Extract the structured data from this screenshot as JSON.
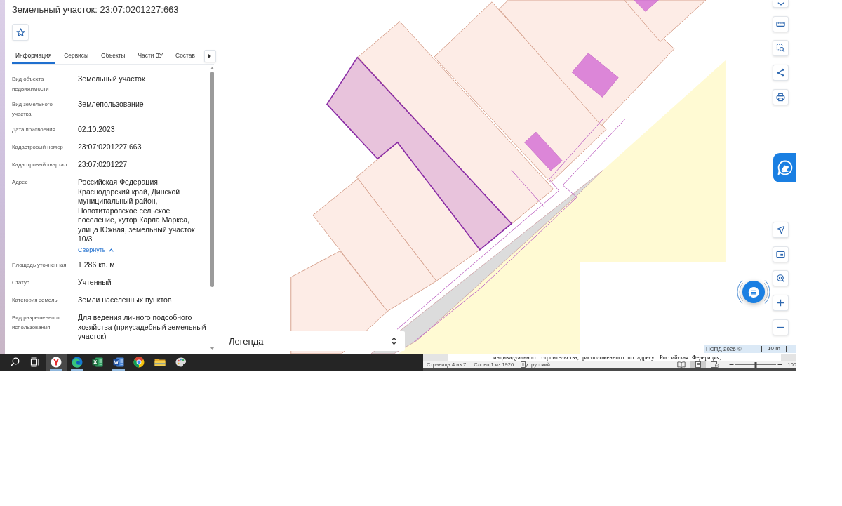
{
  "panel": {
    "title": "Земельный участок: 23:07:0201227:663",
    "tabs": [
      {
        "label": "Информация",
        "selected": true
      },
      {
        "label": "Сервисы",
        "selected": false
      },
      {
        "label": "Объекты",
        "selected": false
      },
      {
        "label": "Части ЗУ",
        "selected": false
      },
      {
        "label": "Состав",
        "selected": false
      }
    ],
    "fields": [
      {
        "label": "Вид объекта\nнедвижимости",
        "value": "Земельный участок"
      },
      {
        "label": "Вид земельного\nучастка",
        "value": "Землепользование"
      },
      {
        "label": "Дата присвоения",
        "value": "02.10.2023"
      },
      {
        "label": "Кадастровый номер",
        "value": "23:07:0201227:663"
      },
      {
        "label": "Кадастровый квартал",
        "value": "23:07:0201227"
      },
      {
        "label": "Адрес",
        "value": "Российская Федерация,\nКраснодарский край, Динской\nмуниципальный район,\nНовотитаровское сельское\nпоселение, хутор Карла Маркса,\nулица Южная, земельный участок\n10/3",
        "toggle": "Свернуть",
        "expanded": true
      },
      {
        "label": "Площадь уточненная",
        "value": "1 286 кв. м"
      },
      {
        "label": "Статус",
        "value": "Учтенный"
      },
      {
        "label": "Категория земель",
        "value": "Земли населенных пунктов"
      },
      {
        "label": "Вид разрешенного\nиспользования",
        "value": "Для ведения личного подсобного\nхозяйства (приусадебный земельный\nучасток)"
      }
    ]
  },
  "map": {
    "legend": "Легенда",
    "attribution": "НСПД 2026 ©",
    "scale": "10 m"
  },
  "taskbar": {
    "items": [
      {
        "kind": "search",
        "running": false,
        "selected": false
      },
      {
        "kind": "task_view",
        "running": false,
        "selected": false
      },
      {
        "kind": "browser_y",
        "running": true,
        "selected": true
      },
      {
        "kind": "browser_wave",
        "running": true,
        "selected": false
      },
      {
        "kind": "spreadsheet",
        "running": false,
        "selected": false
      },
      {
        "kind": "text_editor",
        "running": true,
        "selected": false
      },
      {
        "kind": "browser_ring",
        "running": false,
        "selected": false
      },
      {
        "kind": "folder",
        "running": false,
        "selected": false
      },
      {
        "kind": "palette",
        "running": false,
        "selected": false
      }
    ]
  },
  "word": {
    "document_text": "индивидуального строительства, расположенного по адресу: Российская Федерация,",
    "status_bar": {
      "page": "Страница 4 из 7",
      "words": "Слово 1 из 1926",
      "language": "русский",
      "views": [
        {
          "kind": "read",
          "selected": false
        },
        {
          "kind": "print",
          "selected": true
        },
        {
          "kind": "web",
          "selected": false
        }
      ],
      "zoom": {
        "level": 0.5
      },
      "zoom_value": "100"
    }
  }
}
